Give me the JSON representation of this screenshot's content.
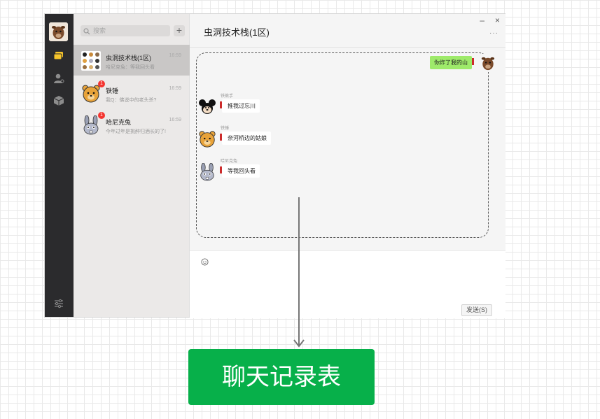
{
  "search": {
    "placeholder": "搜索"
  },
  "sidebar": {
    "add_label": "+",
    "sessions": [
      {
        "name": "虫洞技术栈(1区)",
        "preview": "哈尼克兔：等我回头看",
        "time": "16:59",
        "badge": ""
      },
      {
        "name": "铁锤",
        "preview": "我Q：佛说中的老头杀?",
        "time": "16:59",
        "badge": "1"
      },
      {
        "name": "哈尼克兔",
        "preview": "今年过年是挑醉归酒长的了!",
        "time": "16:59",
        "badge": "1"
      }
    ]
  },
  "chat": {
    "title": "虫洞技术栈(1区)",
    "minimize_label": "–",
    "close_label": "×",
    "more_label": "···",
    "self_message": "你炸了我的山",
    "messages": [
      {
        "sender": "铁锹手",
        "text": "推我过忘川",
        "avatar": "mickey"
      },
      {
        "sender": "铁锤",
        "text": "奈河桥边的姑娘",
        "avatar": "bear"
      },
      {
        "sender": "哈尼克兔",
        "text": "等我回头看",
        "avatar": "rabbit"
      }
    ],
    "send_label": "发送(S)"
  },
  "result": {
    "label": "聊天记录表"
  },
  "colors": {
    "rail": "#2b2b2d",
    "accent": "#07b04a",
    "self_bubble": "#9eea6a",
    "badge": "#f43530"
  }
}
